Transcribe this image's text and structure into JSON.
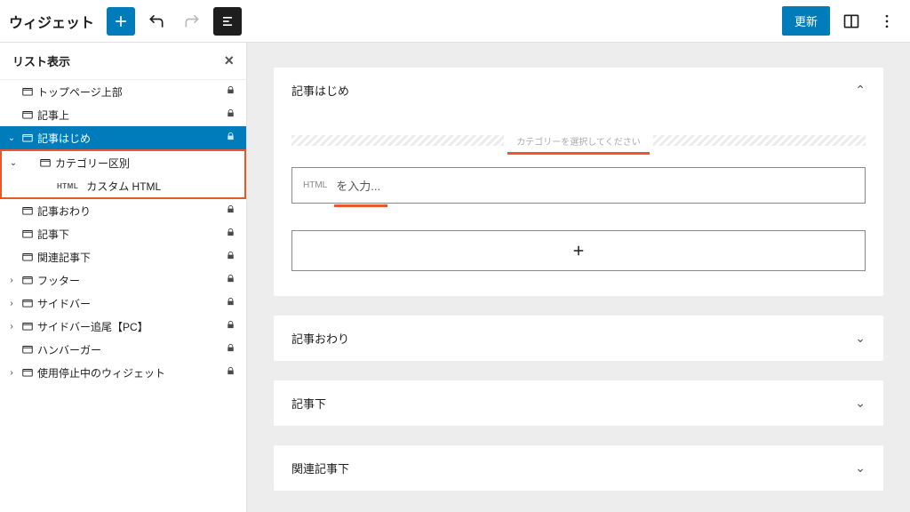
{
  "header": {
    "title": "ウィジェット",
    "update": "更新"
  },
  "sidebar": {
    "title": "リスト表示",
    "items": [
      {
        "label": "トップページ上部",
        "caret": "",
        "locked": true,
        "indent": 0,
        "folder": true
      },
      {
        "label": "記事上",
        "caret": "",
        "locked": true,
        "indent": 0,
        "folder": true
      },
      {
        "label": "記事はじめ",
        "caret": "⌄",
        "locked": true,
        "indent": 0,
        "folder": true,
        "selected": true
      },
      {
        "label": "カテゴリー区別",
        "caret": "⌄",
        "locked": false,
        "indent": 1,
        "folder": true,
        "highlight": true
      },
      {
        "label": "カスタム HTML",
        "caret": "",
        "locked": false,
        "indent": 2,
        "folder": false,
        "html": true,
        "highlight": true
      },
      {
        "label": "記事おわり",
        "caret": "",
        "locked": true,
        "indent": 0,
        "folder": true
      },
      {
        "label": "記事下",
        "caret": "",
        "locked": true,
        "indent": 0,
        "folder": true
      },
      {
        "label": "関連記事下",
        "caret": "",
        "locked": true,
        "indent": 0,
        "folder": true
      },
      {
        "label": "フッター",
        "caret": "›",
        "locked": true,
        "indent": 0,
        "folder": true
      },
      {
        "label": "サイドバー",
        "caret": "›",
        "locked": true,
        "indent": 0,
        "folder": true
      },
      {
        "label": "サイドバー追尾【PC】",
        "caret": "›",
        "locked": true,
        "indent": 0,
        "folder": true
      },
      {
        "label": "ハンバーガー",
        "caret": "",
        "locked": true,
        "indent": 0,
        "folder": true
      },
      {
        "label": "使用停止中のウィジェット",
        "caret": "›",
        "locked": true,
        "indent": 0,
        "folder": true
      }
    ]
  },
  "main": {
    "open_section": {
      "title": "記事はじめ",
      "category_hint": "カテゴリーを選択してください",
      "html_badge": "HTML",
      "html_placeholder": "を入力..."
    },
    "collapsed": [
      {
        "title": "記事おわり"
      },
      {
        "title": "記事下"
      },
      {
        "title": "関連記事下"
      }
    ]
  }
}
